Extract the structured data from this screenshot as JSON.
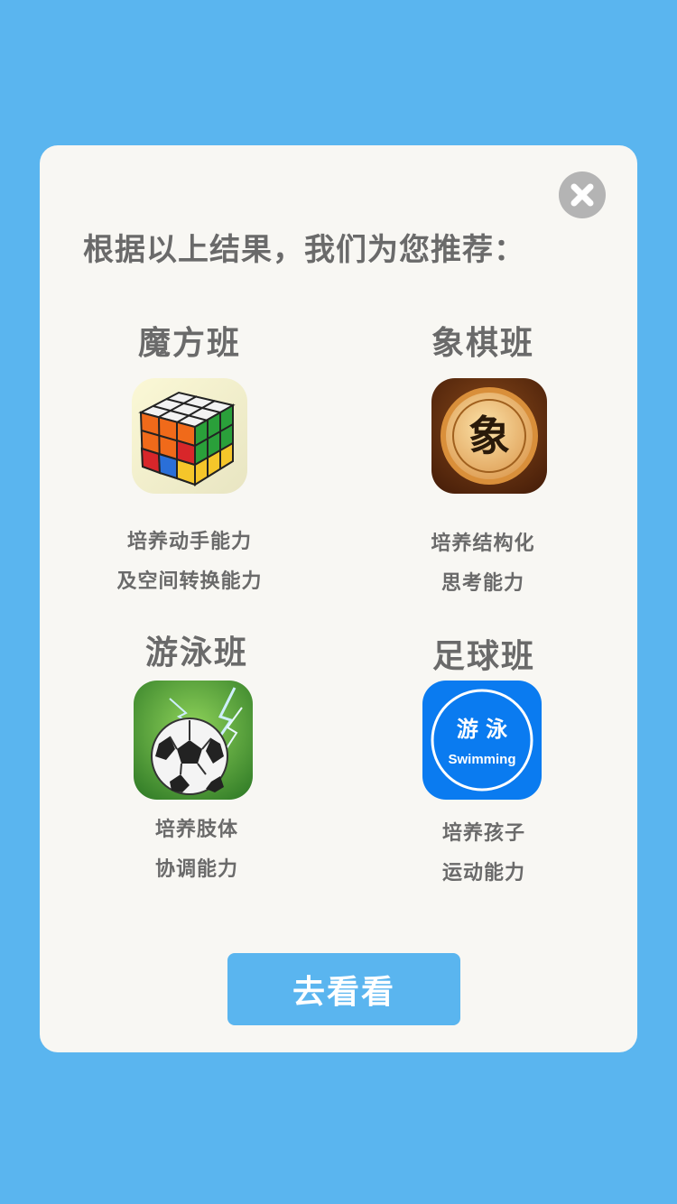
{
  "dialog": {
    "heading": "根据以上结果，我们为您推荐：",
    "close_icon": "close-icon",
    "button_label": "去看看"
  },
  "courses": [
    {
      "name": "魔方班",
      "icon": "rubiks-cube-icon",
      "desc_line1": "培养动手能力",
      "desc_line2": "及空间转换能力"
    },
    {
      "name": "象棋班",
      "icon": "chinese-chess-icon",
      "icon_text": "象",
      "desc_line1": "培养结构化",
      "desc_line2": "思考能力"
    },
    {
      "name": "游泳班",
      "icon": "soccer-ball-icon",
      "desc_line1": "培养肢体",
      "desc_line2": "协调能力"
    },
    {
      "name": "足球班",
      "icon": "swimming-icon",
      "icon_text_cn": "游 泳",
      "icon_text_en": "Swimming",
      "desc_line1": "培养孩子",
      "desc_line2": "运动能力"
    }
  ],
  "colors": {
    "background": "#5ab5ef",
    "card": "#f8f7f3",
    "text": "#6a6a6a",
    "button": "#5ab5ef",
    "close": "#b4b4b4",
    "swimming_icon": "#0a7bf0"
  }
}
